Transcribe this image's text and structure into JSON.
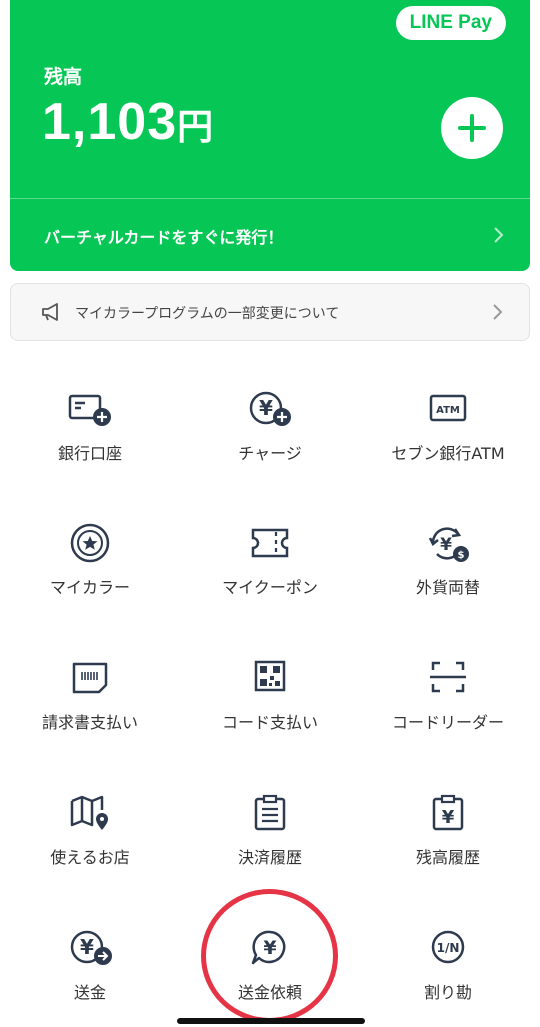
{
  "card": {
    "brand": "LINE Pay",
    "balance_label": "残高",
    "balance_amount": "1,103",
    "balance_unit": "円",
    "promo_link": "バーチャルカードをすぐに発行！"
  },
  "notice": {
    "text": "マイカラープログラムの一部変更について"
  },
  "menu": {
    "row1": [
      "銀行口座",
      "チャージ",
      "セブン銀行ATM"
    ],
    "row2": [
      "マイカラー",
      "マイクーポン",
      "外貨両替"
    ],
    "row3": [
      "請求書支払い",
      "コード支払い",
      "コードリーダー"
    ],
    "row4": [
      "使えるお店",
      "決済履歴",
      "残高履歴"
    ],
    "row5": [
      "送金",
      "送金依頼",
      "割り勘"
    ]
  },
  "icons": {
    "atm_text": "ATM",
    "yen": "¥",
    "split": "1/N"
  },
  "colors": {
    "brand_green": "#06c755",
    "icon_navy": "#2e3a4d",
    "highlight_red": "#e53445"
  }
}
